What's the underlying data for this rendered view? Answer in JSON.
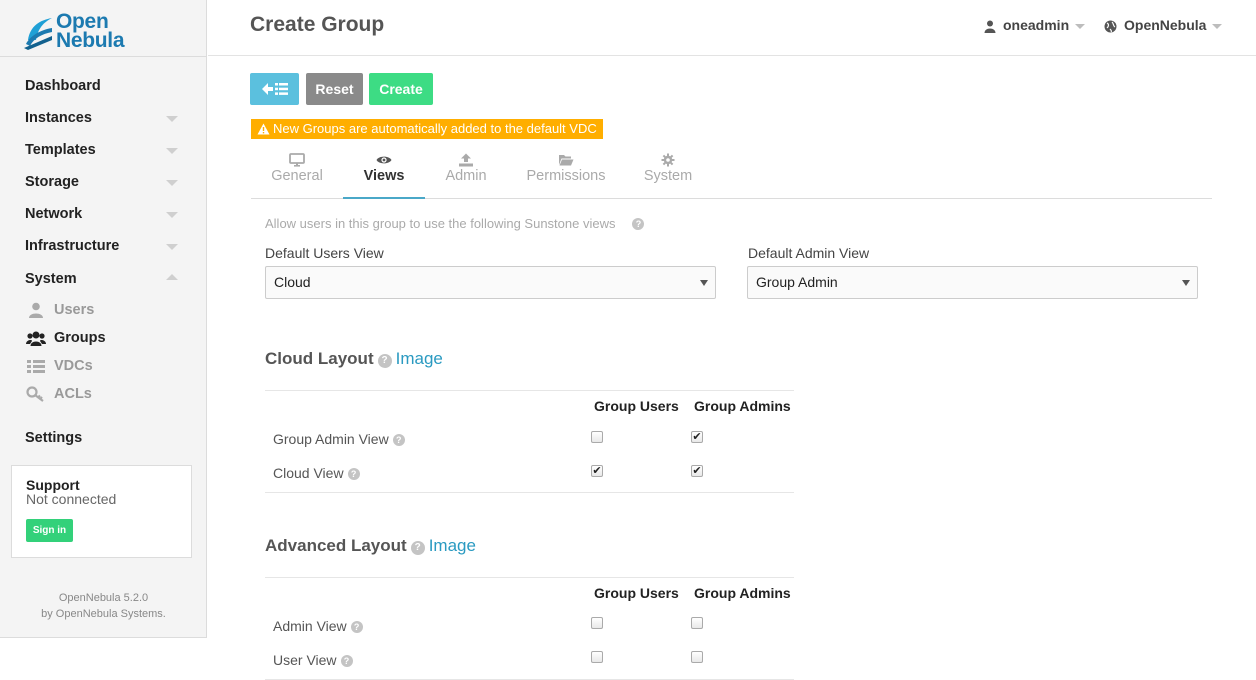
{
  "app": {
    "logo_line1": "Open",
    "logo_line2": "Nebula",
    "version": "OpenNebula 5.2.0",
    "credit": "by OpenNebula Systems."
  },
  "sidebar": {
    "items": [
      {
        "label": "Dashboard",
        "has_caret": false
      },
      {
        "label": "Instances",
        "has_caret": true
      },
      {
        "label": "Templates",
        "has_caret": true
      },
      {
        "label": "Storage",
        "has_caret": true
      },
      {
        "label": "Network",
        "has_caret": true
      },
      {
        "label": "Infrastructure",
        "has_caret": true
      },
      {
        "label": "System",
        "has_caret": true,
        "expanded": true
      }
    ],
    "system_sub": [
      {
        "label": "Users",
        "icon": "user-icon",
        "active": false
      },
      {
        "label": "Groups",
        "icon": "users-icon",
        "active": true
      },
      {
        "label": "VDCs",
        "icon": "list-icon",
        "active": false
      },
      {
        "label": "ACLs",
        "icon": "key-icon",
        "active": false
      }
    ],
    "settings": "Settings",
    "support": {
      "title": "Support",
      "status": "Not connected",
      "signin": "Sign in"
    }
  },
  "header": {
    "title": "Create Group",
    "user": "oneadmin",
    "zone": "OpenNebula"
  },
  "toolbar": {
    "reset": "Reset",
    "create": "Create",
    "warning": "New Groups are automatically added to the default VDC"
  },
  "tabs": [
    {
      "label": "General",
      "icon": "monitor-icon"
    },
    {
      "label": "Views",
      "icon": "eye-icon",
      "active": true
    },
    {
      "label": "Admin",
      "icon": "upload-icon"
    },
    {
      "label": "Permissions",
      "icon": "folder-open-icon"
    },
    {
      "label": "System",
      "icon": "gear-icon"
    }
  ],
  "views": {
    "hint": "Allow users in this group to use the following Sunstone views",
    "default_users_label": "Default Users View",
    "default_users_value": "Cloud",
    "default_admin_label": "Default Admin View",
    "default_admin_value": "Group Admin",
    "cloud_layout": {
      "title": "Cloud Layout",
      "link": "Image",
      "col_users": "Group Users",
      "col_admins": "Group Admins",
      "rows": [
        {
          "label": "Group Admin View",
          "users": false,
          "admins": true
        },
        {
          "label": "Cloud View",
          "users": true,
          "admins": true
        }
      ]
    },
    "advanced_layout": {
      "title": "Advanced Layout",
      "link": "Image",
      "col_users": "Group Users",
      "col_admins": "Group Admins",
      "rows": [
        {
          "label": "Admin View",
          "users": false,
          "admins": false
        },
        {
          "label": "User View",
          "users": false,
          "admins": false
        }
      ]
    }
  },
  "colors": {
    "brand": "#1c7ab0",
    "back_button": "#5bc0de",
    "reset_button": "#8a8a8a",
    "create_button": "#3ddc84",
    "warning": "#ffae00",
    "link": "#2a9ac1"
  }
}
